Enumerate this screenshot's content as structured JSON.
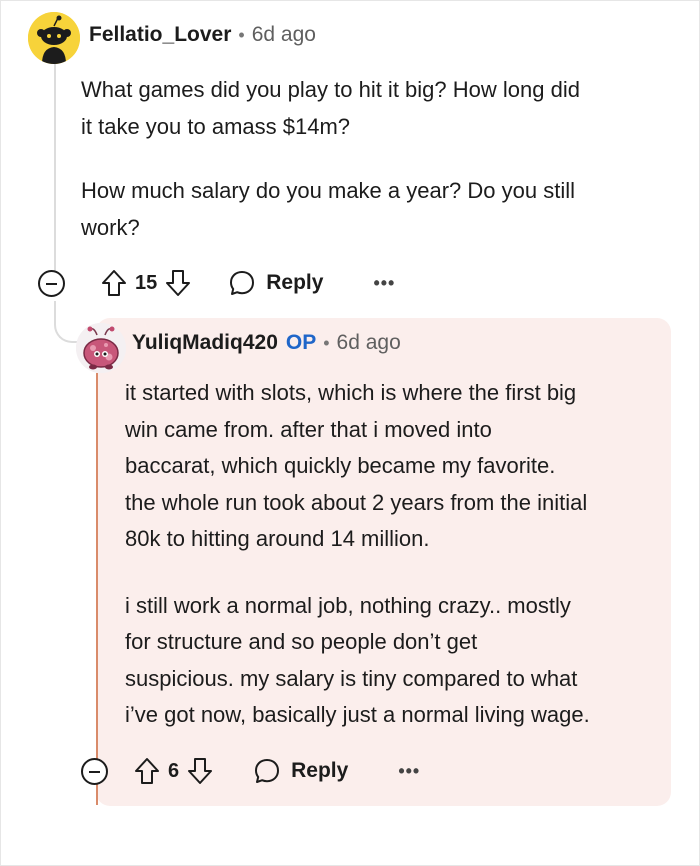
{
  "comment": {
    "author": "Fellatio_Lover",
    "separator": "•",
    "time_ago": "6d ago",
    "body_paragraph_1": [
      "What games did you play to hit it big? How long did",
      "it take you to amass $14m?"
    ],
    "body_paragraph_2": [
      "How much salary do you make a year? Do you still",
      "work?"
    ],
    "upvotes": "15",
    "reply_label": "Reply",
    "more_label": "•••",
    "avatar_color": "#f7d33a"
  },
  "reply": {
    "author": "YuliqMadiq420",
    "op_badge": "OP",
    "separator": "•",
    "time_ago": "6d ago",
    "body_paragraph_1": [
      "it started with slots, which is where the first big",
      "win came from. after that i moved into",
      "baccarat, which quickly became my favorite.",
      "the whole run took about 2 years from the initial",
      "80k to hitting around 14 million."
    ],
    "body_paragraph_2": [
      "i still work a normal job, nothing crazy.. mostly",
      "for structure and so people don’t get",
      "suspicious. my salary is tiny compared to what",
      "i’ve got now, basically just a normal living wage."
    ],
    "upvotes": "6",
    "reply_label": "Reply",
    "more_label": "•••",
    "card_color": "#fbeeec",
    "op_color": "#1f66c9",
    "thread_accent": "#d98b6a"
  }
}
